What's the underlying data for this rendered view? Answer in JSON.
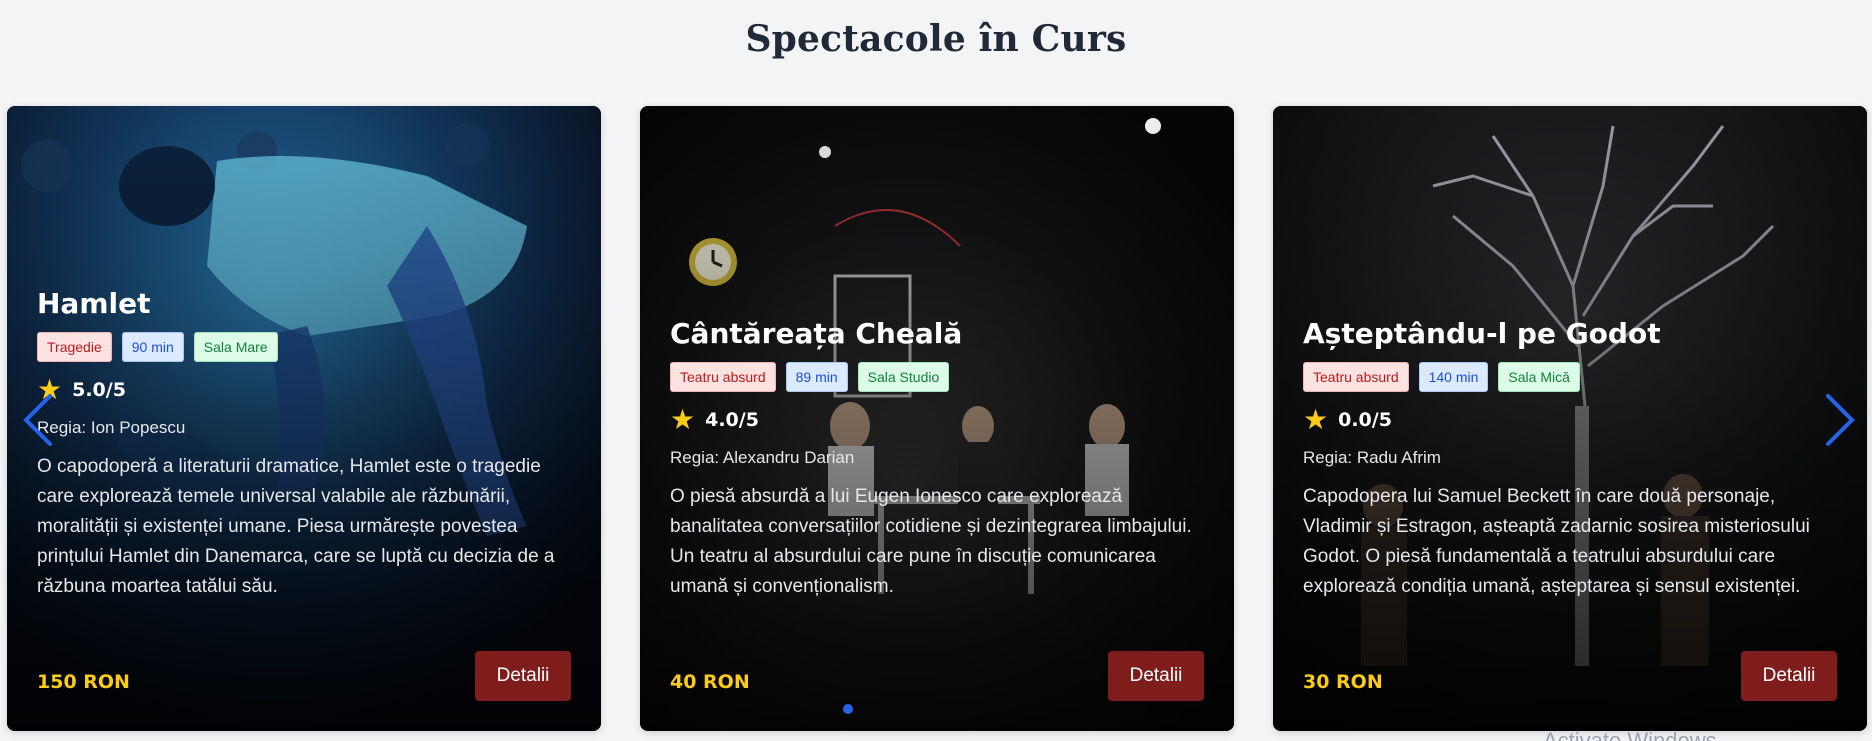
{
  "page": {
    "title": "Spectacole în Curs"
  },
  "shows": [
    {
      "title": "Hamlet",
      "genre": "Tragedie",
      "duration": "90 min",
      "hall": "Sala Mare",
      "rating": "5.0/5",
      "director": "Regia: Ion Popescu",
      "description": "O capodoperă a literaturii dramatice, Hamlet este o tragedie care explorează temele universal valabile ale răzbunării, moralității și existenței umane. Piesa urmărește povestea prințului Hamlet din Danemarca, care se luptă cu decizia de a răzbuna moartea tatălui său.",
      "price": "150 RON",
      "button": "Detalii"
    },
    {
      "title": "Cântăreața Cheală",
      "genre": "Teatru absurd",
      "duration": "89 min",
      "hall": "Sala Studio",
      "rating": "4.0/5",
      "director": "Regia: Alexandru Darian",
      "description": "O piesă absurdă a lui Eugen Ionesco care explorează banalitatea conversațiilor cotidiene și dezintegrarea limbajului. Un teatru al absurdului care pune în discuție comunicarea umană și convenționalism.",
      "price": "40 RON",
      "button": "Detalii"
    },
    {
      "title": "Așteptându-l pe Godot",
      "genre": "Teatru absurd",
      "duration": "140 min",
      "hall": "Sala Mică",
      "rating": "0.0/5",
      "director": "Regia: Radu Afrim",
      "description": "Capodopera lui Samuel Beckett în care două personaje, Vladimir și Estragon, așteaptă zadarnic sosirea misteriosului Godot. O piesă fundamentală a teatrului absurdului care explorează condiția umană, așteptarea și sensul existenței.",
      "price": "30 RON",
      "button": "Detalii"
    }
  ],
  "carousel": {
    "prev_icon": "chevron-left-icon",
    "next_icon": "chevron-right-icon",
    "active_dot": 1
  },
  "overlay": {
    "watermark": "Activate Windows"
  },
  "colors": {
    "background": "#f3f4f6",
    "button": "#7f1d1d",
    "price": "#facc15",
    "star": "#facc15",
    "arrow": "#2563eb"
  }
}
